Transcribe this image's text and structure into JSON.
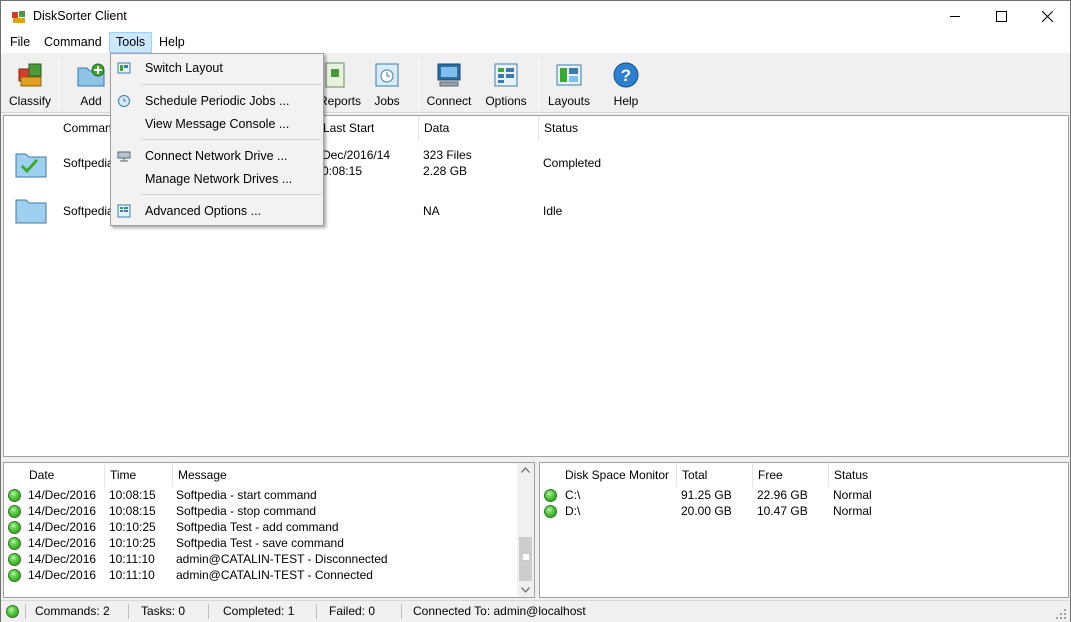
{
  "window": {
    "title": "DiskSorter Client"
  },
  "menubar": {
    "items": [
      "File",
      "Command",
      "Tools",
      "Help"
    ]
  },
  "toolbar": {
    "classify": "Classify",
    "add": "Add",
    "reports": "Reports",
    "jobs": "Jobs",
    "connect": "Connect",
    "options": "Options",
    "layouts": "Layouts",
    "help": "Help"
  },
  "tools_menu": {
    "switch_layout": "Switch Layout",
    "schedule_jobs": "Schedule Periodic Jobs ...",
    "message_console": "View Message Console ...",
    "connect_drive": "Connect Network Drive ...",
    "manage_drives": "Manage Network Drives ...",
    "advanced_options": "Advanced Options ..."
  },
  "commands": {
    "headers": {
      "command": "Command",
      "last_start": "Last Start",
      "data": "Data",
      "status": "Status"
    },
    "rows": [
      {
        "name": "Softpedia",
        "date": "14/Dec/2016",
        "time": "10:08:15",
        "files": "323 Files",
        "size": "2.28 GB",
        "status": "Completed"
      },
      {
        "name": "Softpedia Test",
        "data": "NA",
        "status": "Idle"
      }
    ]
  },
  "log": {
    "headers": {
      "date": "Date",
      "time": "Time",
      "message": "Message"
    },
    "rows": [
      {
        "date": "14/Dec/2016",
        "time": "10:08:15",
        "message": "Softpedia - start command"
      },
      {
        "date": "14/Dec/2016",
        "time": "10:08:15",
        "message": "Softpedia - stop command"
      },
      {
        "date": "14/Dec/2016",
        "time": "10:10:25",
        "message": "Softpedia Test - add command"
      },
      {
        "date": "14/Dec/2016",
        "time": "10:10:25",
        "message": "Softpedia Test - save command"
      },
      {
        "date": "14/Dec/2016",
        "time": "10:11:10",
        "message": "admin@CATALIN-TEST - Disconnected"
      },
      {
        "date": "14/Dec/2016",
        "time": "10:11:10",
        "message": "admin@CATALIN-TEST - Connected"
      }
    ]
  },
  "disk": {
    "headers": {
      "monitor": "Disk Space Monitor",
      "total": "Total",
      "free": "Free",
      "status": "Status"
    },
    "rows": [
      {
        "drive": "C:\\",
        "total": "91.25 GB",
        "free": "22.96 GB",
        "status": "Normal"
      },
      {
        "drive": "D:\\",
        "total": "20.00 GB",
        "free": "10.47 GB",
        "status": "Normal"
      }
    ]
  },
  "statusbar": {
    "commands": "Commands: 2",
    "tasks": "Tasks: 0",
    "completed": "Completed: 1",
    "failed": "Failed: 0",
    "connected": "Connected To: admin@localhost"
  },
  "colors": {
    "menu_highlight": "#cce8ff",
    "status_ok": "#4fc43a"
  }
}
